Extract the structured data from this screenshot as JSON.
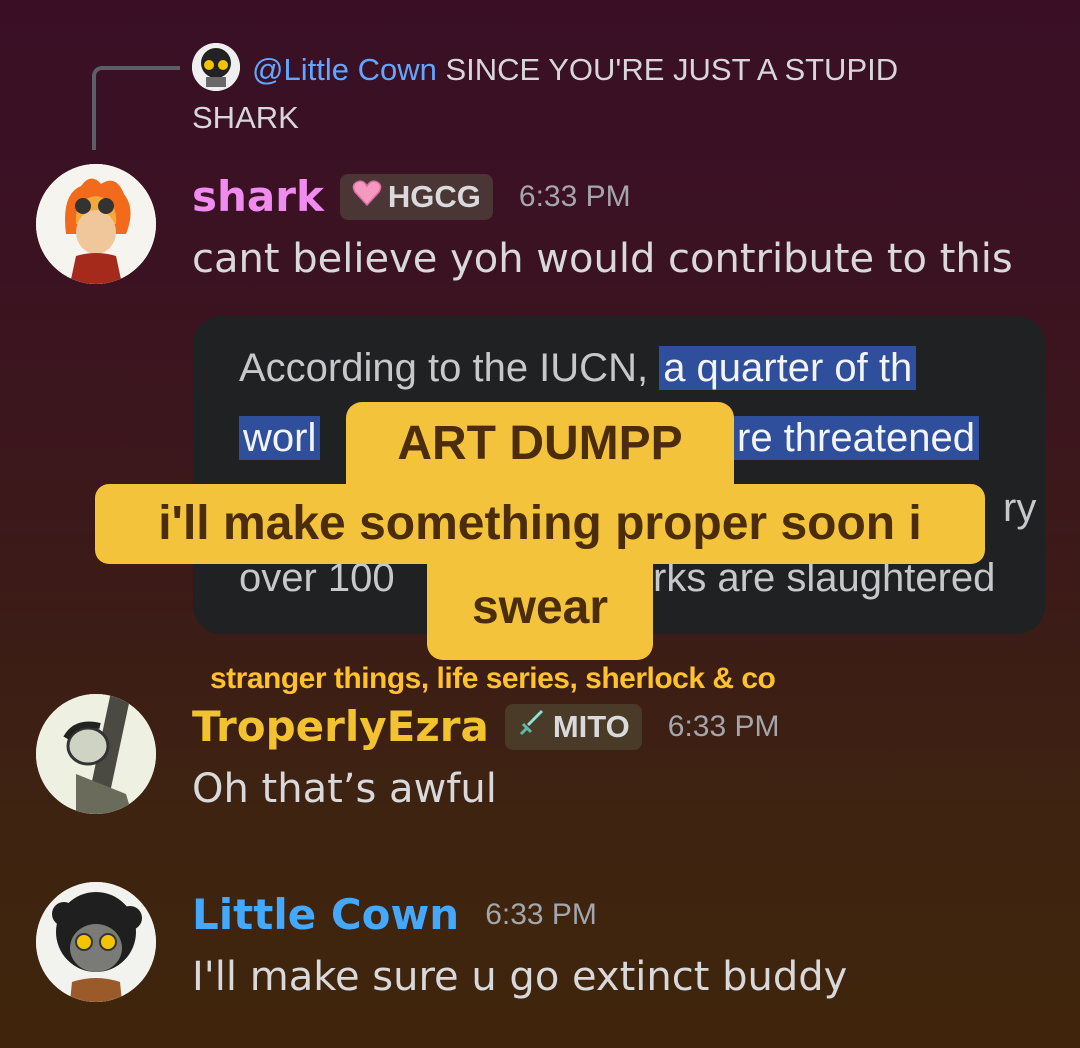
{
  "reply": {
    "mention": "@Little Cown",
    "text": "SINCE YOU'RE JUST A STUPID SHARK"
  },
  "messages": [
    {
      "username": "shark",
      "username_color": "#f08cf0",
      "tag_icon": "heart-icon",
      "tag": "HGCG",
      "time": "6:33 PM",
      "text": "cant believe yoh would contribute to this"
    },
    {
      "username": "TroperlyEzra",
      "username_color": "#f2c230",
      "tag_icon": "sword-icon",
      "tag": "MITO",
      "time": "6:33 PM",
      "text": "Oh that’s awful"
    },
    {
      "username": "Little Cown",
      "username_color": "#45a8ff",
      "time": "6:33 PM",
      "text": "I'll make sure u go extinct buddy"
    }
  ],
  "embed": {
    "line1_plain": "According to the IUCN,",
    "line1_highlight": "a quarter of th",
    "line2_left": "worl",
    "line2_right": "re threatened",
    "line3_right": "ry",
    "line4_left": "over 100",
    "line4_right": "rks are slaughtered"
  },
  "overlay": {
    "title": "ART DUMPP",
    "line1": "i'll make something proper soon i",
    "line2": "swear",
    "caption": "stranger things, life series, sherlock & co"
  }
}
